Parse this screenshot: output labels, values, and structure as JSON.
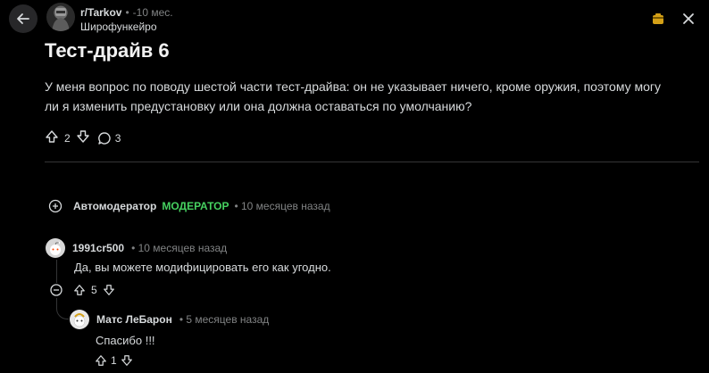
{
  "header": {
    "subreddit": "r/Tarkov",
    "separator": "•",
    "age": "-10 мес.",
    "author": "Широфункейро"
  },
  "post": {
    "title": "Тест-драйв 6",
    "body": "У меня вопрос по поводу шестой части тест-драйва: он не указывает ничего, кроме оружия, поэтому могу ли я изменить предустановку или она должна оставаться по умолчанию?",
    "upvotes": "2",
    "comments": "3"
  },
  "comments": [
    {
      "author": "Автомодератор",
      "badge": "МОДЕРАТОР",
      "time": "• 10 месяцев назад",
      "collapsed": true
    },
    {
      "author": "1991cr500",
      "time": "• 10 месяцев назад",
      "text": "Да, вы можете модифицировать его как угодно.",
      "upvotes": "5"
    },
    {
      "author": "Матс ЛеБарон",
      "time": "• 5 месяцев назад",
      "text": "Спасибо !!!",
      "upvotes": "1"
    }
  ],
  "colors": {
    "background": "#000000",
    "text": "#d7dadc",
    "muted": "#818384",
    "moderator": "#46d160",
    "award": "#d4a017"
  },
  "icons": [
    "back-arrow-icon",
    "award-icon",
    "close-icon",
    "upvote-icon",
    "downvote-icon",
    "comment-icon",
    "expand-plus-icon",
    "collapse-minus-icon",
    "snoo-avatar-icon"
  ]
}
